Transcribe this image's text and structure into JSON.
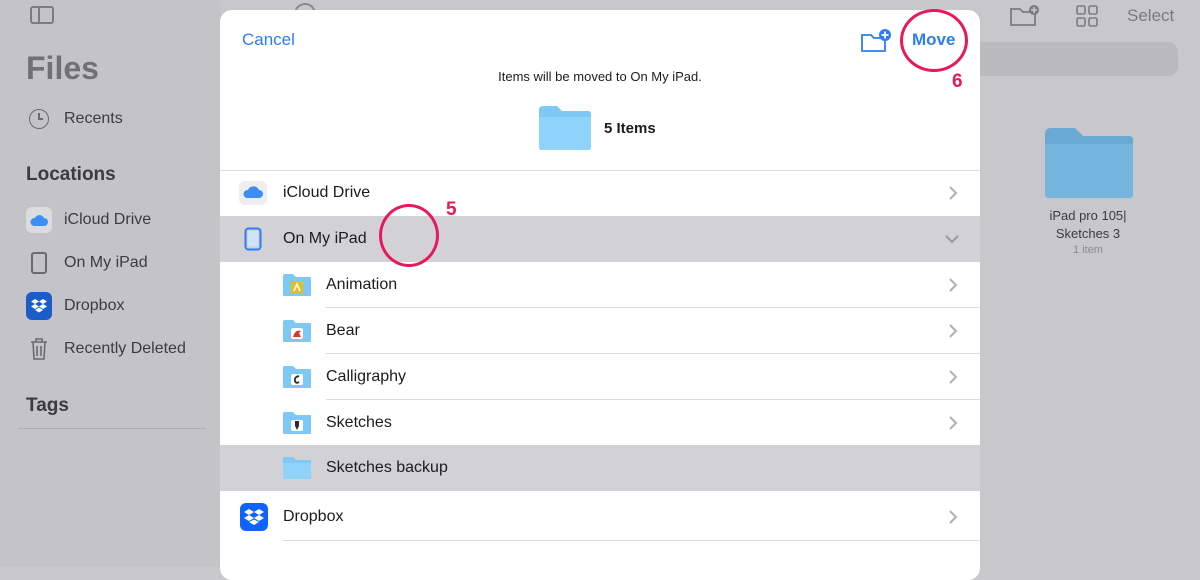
{
  "background": {
    "sidebar": {
      "title": "Files",
      "recents_label": "Recents",
      "locations_heading": "Locations",
      "locations": [
        {
          "label": "iCloud Drive",
          "icon": "icloud-icon"
        },
        {
          "label": "On My iPad",
          "icon": "ipad-icon"
        },
        {
          "label": "Dropbox",
          "icon": "dropbox-icon"
        },
        {
          "label": "Recently Deleted",
          "icon": "trash-icon"
        }
      ],
      "tags_heading": "Tags"
    },
    "toolbar": {
      "select_label": "Select"
    },
    "folder": {
      "name_line1": "iPad pro 105|",
      "name_line2": "Sketches 3",
      "count": "1 item"
    }
  },
  "sheet": {
    "cancel_label": "Cancel",
    "move_label": "Move",
    "destination_note": "Items will be moved to On My iPad.",
    "items_label": "5 Items",
    "rows": [
      {
        "label": "iCloud Drive",
        "icon": "icloud-icon",
        "level": 0,
        "selected": false,
        "chevron": "right"
      },
      {
        "label": "On My iPad",
        "icon": "ipad-icon",
        "level": 0,
        "selected": true,
        "chevron": "down"
      },
      {
        "label": "Animation",
        "icon": "folder-animation-icon",
        "level": 1,
        "selected": false,
        "chevron": "right"
      },
      {
        "label": "Bear",
        "icon": "folder-bear-icon",
        "level": 1,
        "selected": false,
        "chevron": "right"
      },
      {
        "label": "Calligraphy",
        "icon": "folder-calligraphy-icon",
        "level": 1,
        "selected": false,
        "chevron": "right"
      },
      {
        "label": "Sketches",
        "icon": "folder-sketches-icon",
        "level": 1,
        "selected": false,
        "chevron": "right"
      },
      {
        "label": "Sketches backup",
        "icon": "folder-icon",
        "level": 1,
        "selected": true,
        "chevron": "none"
      },
      {
        "label": "Dropbox",
        "icon": "dropbox-icon",
        "level": 0,
        "selected": false,
        "chevron": "right"
      }
    ]
  },
  "annotations": {
    "step5": "5",
    "step6": "6"
  },
  "colors": {
    "accent": "#2f7df6",
    "annotation": "#e8185a",
    "selected_row": "#d1d1d6",
    "folder": "#7ec8f5"
  }
}
